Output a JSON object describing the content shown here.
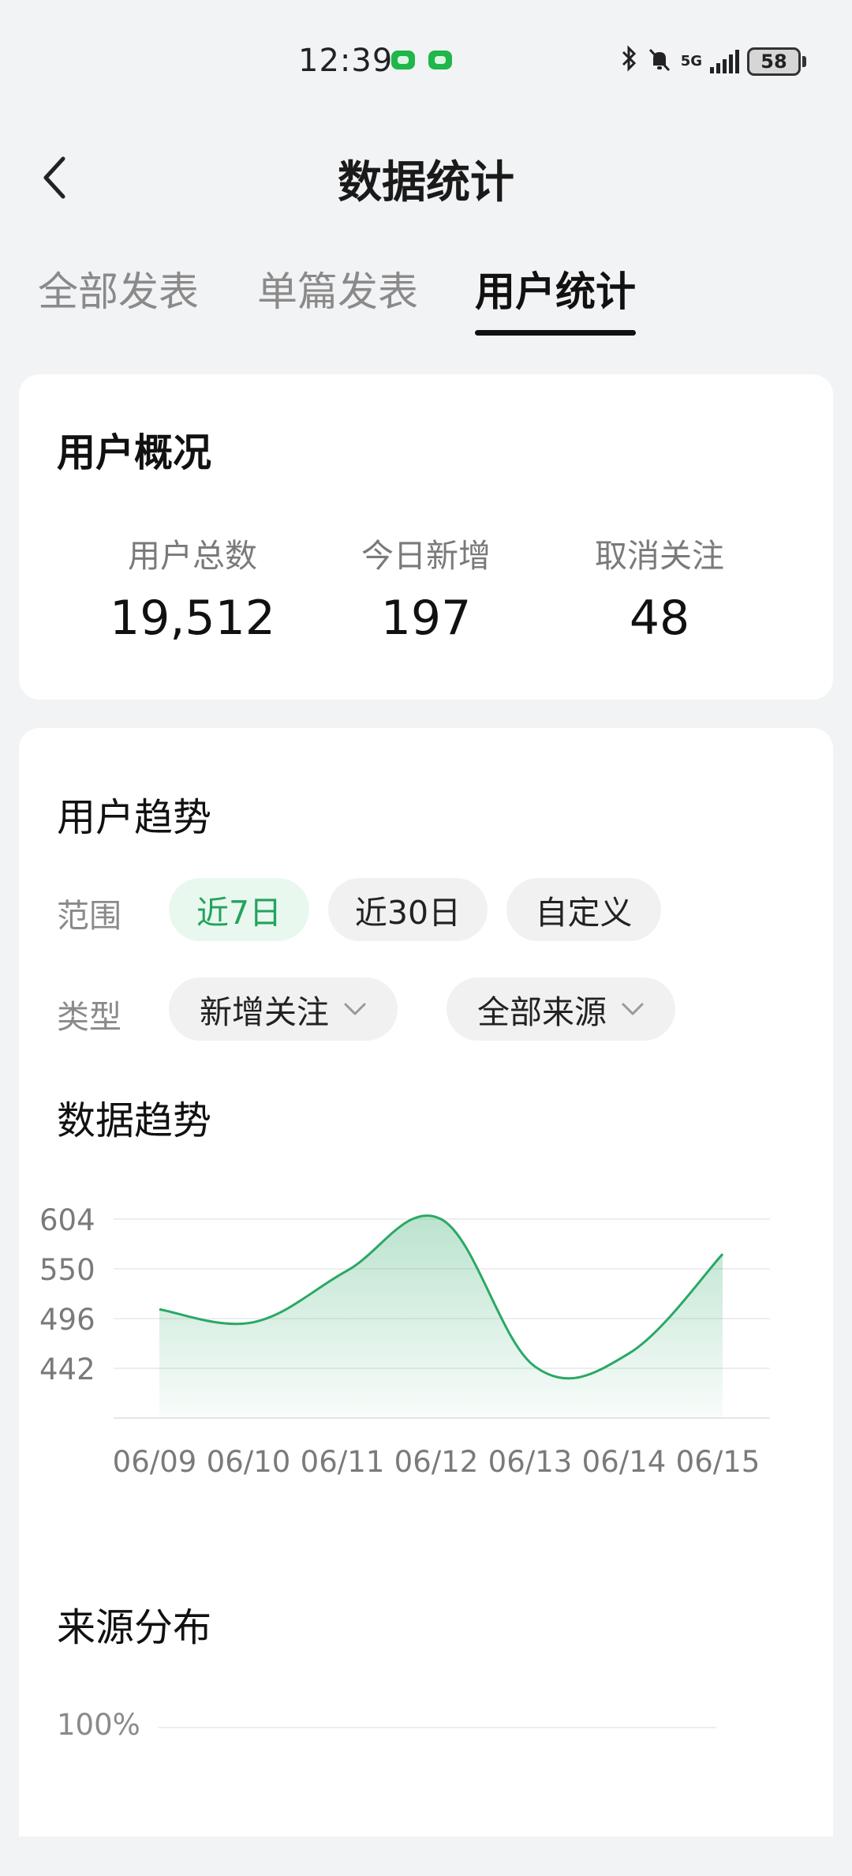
{
  "status_bar": {
    "time": "12:39",
    "network": "5G",
    "battery": "58",
    "icons": [
      "wechat-notification-icon",
      "wechat-notification-icon",
      "bluetooth-icon",
      "mute-icon",
      "signal-icon",
      "battery-icon"
    ]
  },
  "header": {
    "title": "数据统计",
    "back_icon": "chevron-left-icon"
  },
  "tabs": [
    {
      "label": "全部发表",
      "active": false
    },
    {
      "label": "单篇发表",
      "active": false
    },
    {
      "label": "用户统计",
      "active": true
    }
  ],
  "overview": {
    "title": "用户概况",
    "stats": [
      {
        "label": "用户总数",
        "value": "19,512"
      },
      {
        "label": "今日新增",
        "value": "197"
      },
      {
        "label": "取消关注",
        "value": "48"
      }
    ]
  },
  "trend": {
    "title": "用户趋势",
    "range_label": "范围",
    "range_options": [
      {
        "label": "近7日",
        "selected": true
      },
      {
        "label": "近30日",
        "selected": false
      },
      {
        "label": "自定义",
        "selected": false
      }
    ],
    "type_label": "类型",
    "type_selects": [
      {
        "label": "新增关注",
        "icon": "chevron-down-icon"
      },
      {
        "label": "全部来源",
        "icon": "chevron-down-icon"
      }
    ],
    "data_trend_title": "数据趋势",
    "source_title": "来源分布",
    "source_y_tick": "100%"
  },
  "colors": {
    "accent": "#22a45d",
    "chip_selected_bg": "#e9f8ef",
    "line": "#2aa866"
  },
  "chart_data": {
    "type": "area",
    "categories": [
      "06/09",
      "06/10",
      "06/11",
      "06/12",
      "06/13",
      "06/14",
      "06/15"
    ],
    "values": [
      506,
      492,
      548,
      604,
      444,
      458,
      566
    ],
    "yticks": [
      442,
      496,
      550,
      604
    ],
    "ylim": [
      388,
      604
    ],
    "grid": true,
    "title": "",
    "xlabel": "",
    "ylabel": ""
  }
}
